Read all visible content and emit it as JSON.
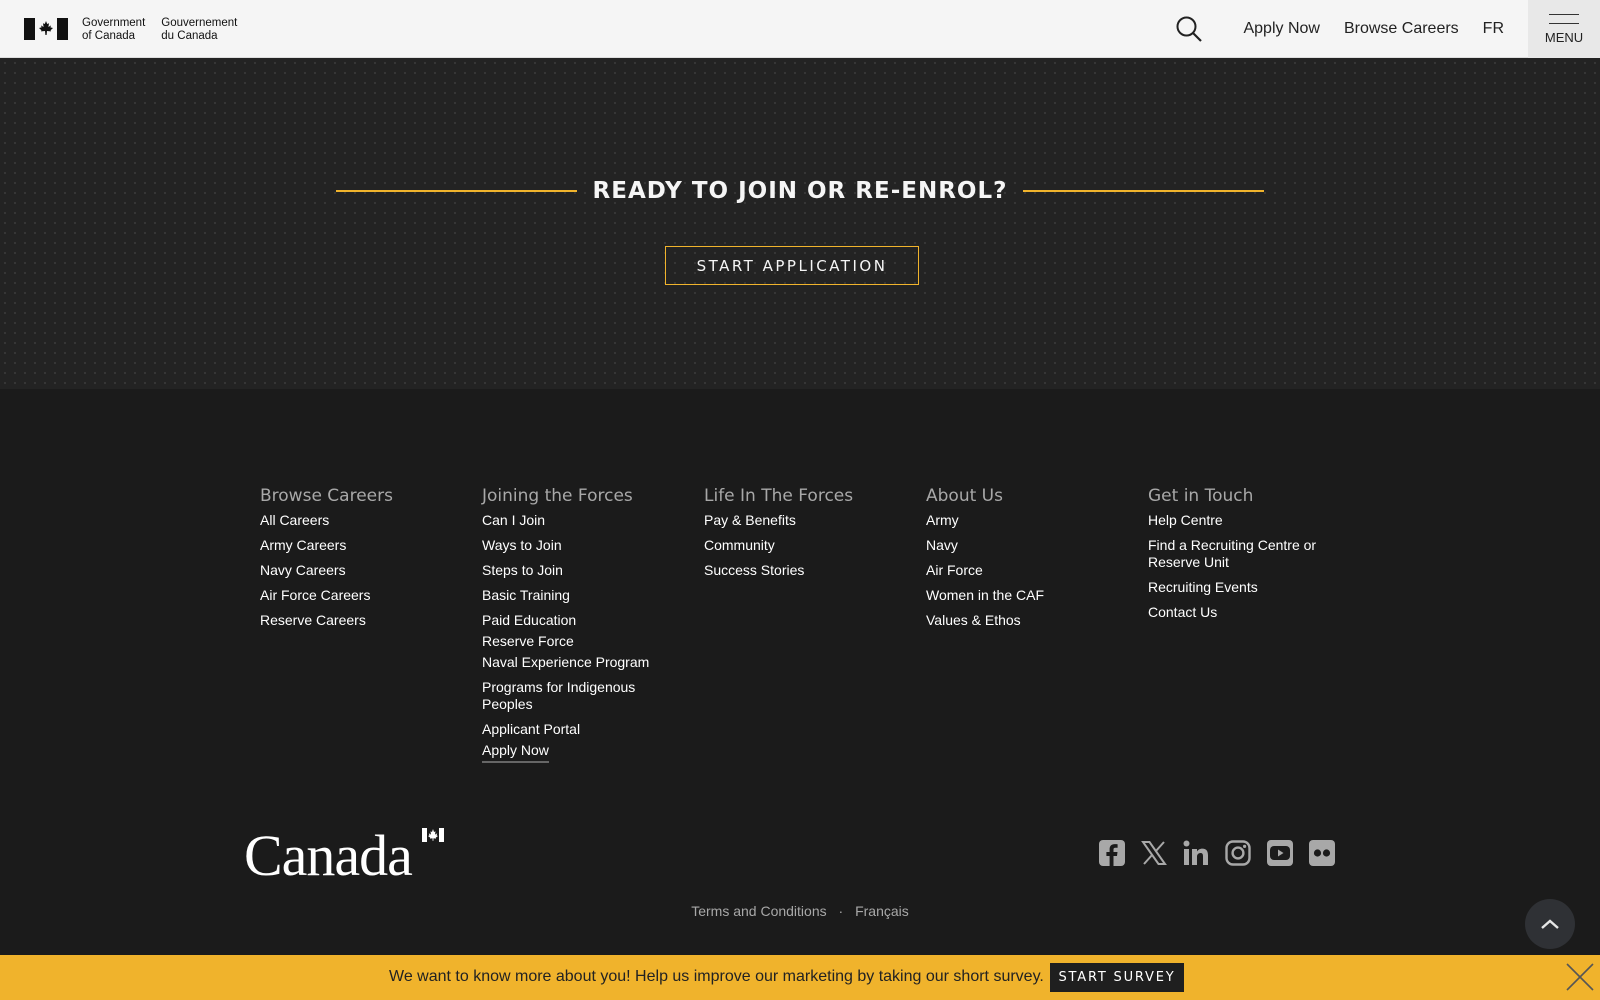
{
  "header": {
    "gov_en_line1": "Government",
    "gov_en_line2": "of Canada",
    "gov_fr_line1": "Gouvernement",
    "gov_fr_line2": "du Canada",
    "nav": {
      "apply_now": "Apply Now",
      "browse_careers": "Browse Careers",
      "fr": "FR"
    },
    "menu_label": "MENU"
  },
  "cta": {
    "title": "READY TO JOIN OR RE-ENROL?",
    "button": "START APPLICATION"
  },
  "footer": {
    "columns": [
      {
        "heading": "Browse Careers",
        "links": [
          "All Careers",
          "Army Careers",
          "Navy Careers",
          "Air Force Careers",
          "Reserve Careers"
        ]
      },
      {
        "heading": "Joining the Forces",
        "links": [
          "Can I Join",
          "Ways to Join",
          "Steps to Join",
          "Basic Training",
          "Paid Education",
          "Reserve Force",
          "Naval Experience Program",
          "Programs for Indigenous Peoples",
          "Applicant Portal",
          "Apply Now"
        ]
      },
      {
        "heading": "Life In The Forces",
        "links": [
          "Pay & Benefits",
          "Community",
          "Success Stories"
        ]
      },
      {
        "heading": "About Us",
        "links": [
          "Army",
          "Navy",
          "Air Force",
          "Women in the CAF",
          "Values & Ethos"
        ]
      },
      {
        "heading": "Get in Touch",
        "links": [
          "Help Centre",
          "Find a Recruiting Centre or Reserve Unit",
          "Recruiting Events",
          "Contact Us"
        ]
      }
    ],
    "wordmark": "Canada",
    "legal": {
      "terms": "Terms and Conditions",
      "separator": "·",
      "francais": "Français"
    },
    "socials": [
      "facebook-icon",
      "x-icon",
      "linkedin-icon",
      "instagram-icon",
      "youtube-icon",
      "flickr-icon"
    ]
  },
  "survey": {
    "text": "We want to know more about you! Help us improve our marketing by taking our short survey.",
    "button": "START SURVEY"
  },
  "colors": {
    "accent": "#f0b32c",
    "footer_bg": "#1b1b1b",
    "header_bg": "#f5f5f5"
  }
}
